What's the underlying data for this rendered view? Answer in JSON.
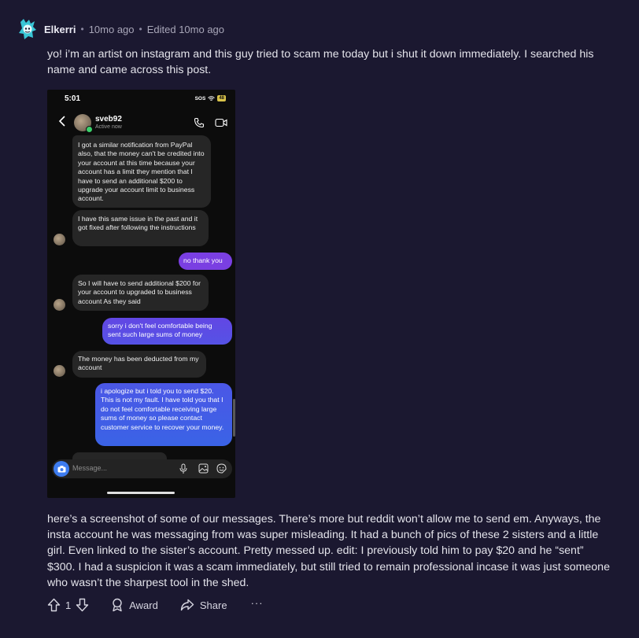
{
  "comment": {
    "username": "Elkerri",
    "separator": "•",
    "time": "10mo ago",
    "edited": "Edited 10mo ago",
    "paragraph1": "yo! i’m an artist on instagram and this guy tried to scam me today but i shut it down immediately. I searched his name and came across this post.",
    "paragraph2": "here’s a screenshot of some of our messages. There’s more but reddit won’t allow me to send em. Anyways, the insta account he was messaging from was super misleading. It had a bunch of pics of these 2 sisters and a little girl. Even linked to the sister’s account. Pretty messed up. edit: I previously told him to pay $20 and he “sent” $300. I had a suspicion it was a scam immediately, but still tried to remain professional incase it was just someone who wasn’t the sharpest tool in the shed."
  },
  "screenshot": {
    "time": "5:01",
    "sos": "SOS",
    "battery": "48",
    "contact_name": "sveb92",
    "contact_status": "Active now",
    "messages": [
      {
        "from": "them",
        "text": "I got a similar notification from PayPal also, that the money can't be credited into your account at this time because your account has a limit they mention that I have to send an additional $200 to upgrade your account limit to business account."
      },
      {
        "from": "them",
        "text": "I have this same issue in the past and it got fixed after following the instructions"
      },
      {
        "from": "me",
        "text": "no thank you"
      },
      {
        "from": "them",
        "text": "So I will have to send additional $200 for your account to upgraded to business account As they said"
      },
      {
        "from": "me",
        "text": "sorry i don't feel comfortable being sent such large sums of money"
      },
      {
        "from": "them",
        "text": "The money has been deducted from my account"
      },
      {
        "from": "me",
        "text": "i apologize but i told you to send $20. This is not my fault. I have told you that I do not feel comfortable receiving large sums of money so please contact customer service to recover your money."
      }
    ],
    "input_placeholder": "Message..."
  },
  "actions": {
    "vote_count": "1",
    "award_label": "Award",
    "share_label": "Share",
    "more_label": "···"
  },
  "colors": {
    "background": "#1b1830",
    "outgoing_top": "#7b3fe0",
    "outgoing_bottom": "#3a63e6",
    "incoming": "#262626"
  }
}
